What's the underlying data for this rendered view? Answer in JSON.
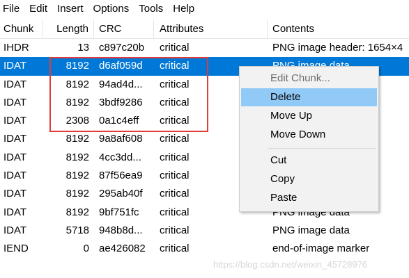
{
  "menubar": {
    "items": [
      "File",
      "Edit",
      "Insert",
      "Options",
      "Tools",
      "Help"
    ]
  },
  "columns": [
    "Chunk",
    "Length",
    "CRC",
    "Attributes",
    "Contents"
  ],
  "rows": [
    {
      "chunk": "IHDR",
      "length": "13",
      "crc": "c897c20b",
      "attributes": "critical",
      "contents": "PNG image header: 1654×4",
      "selected": false
    },
    {
      "chunk": "IDAT",
      "length": "8192",
      "crc": "d6af059d",
      "attributes": "critical",
      "contents": "PNG image data",
      "selected": true
    },
    {
      "chunk": "IDAT",
      "length": "8192",
      "crc": "94ad4d...",
      "attributes": "critical",
      "contents": "",
      "selected": false
    },
    {
      "chunk": "IDAT",
      "length": "8192",
      "crc": "3bdf9286",
      "attributes": "critical",
      "contents": "",
      "selected": false
    },
    {
      "chunk": "IDAT",
      "length": "2308",
      "crc": "0a1c4eff",
      "attributes": "critical",
      "contents": "",
      "selected": false
    },
    {
      "chunk": "IDAT",
      "length": "8192",
      "crc": "9a8af608",
      "attributes": "critical",
      "contents": "",
      "selected": false
    },
    {
      "chunk": "IDAT",
      "length": "8192",
      "crc": "4cc3dd...",
      "attributes": "critical",
      "contents": "",
      "selected": false
    },
    {
      "chunk": "IDAT",
      "length": "8192",
      "crc": "87f56ea9",
      "attributes": "critical",
      "contents": "",
      "selected": false
    },
    {
      "chunk": "IDAT",
      "length": "8192",
      "crc": "295ab40f",
      "attributes": "critical",
      "contents": "",
      "selected": false
    },
    {
      "chunk": "IDAT",
      "length": "8192",
      "crc": "9bf751fc",
      "attributes": "critical",
      "contents": "PNG image data",
      "selected": false
    },
    {
      "chunk": "IDAT",
      "length": "5718",
      "crc": "948b8d...",
      "attributes": "critical",
      "contents": "PNG image data",
      "selected": false
    },
    {
      "chunk": "IEND",
      "length": "0",
      "crc": "ae426082",
      "attributes": "critical",
      "contents": "end-of-image marker",
      "selected": false
    }
  ],
  "context_menu": {
    "edit_chunk": "Edit Chunk...",
    "delete": "Delete",
    "move_up": "Move Up",
    "move_down": "Move Down",
    "cut": "Cut",
    "copy": "Copy",
    "paste": "Paste"
  },
  "watermark": "https://blog.csdn.net/weixin_45728976",
  "colors": {
    "selection": "#0078d7",
    "highlight_box": "#e03c3c",
    "menu_hover": "#91c9f7"
  }
}
